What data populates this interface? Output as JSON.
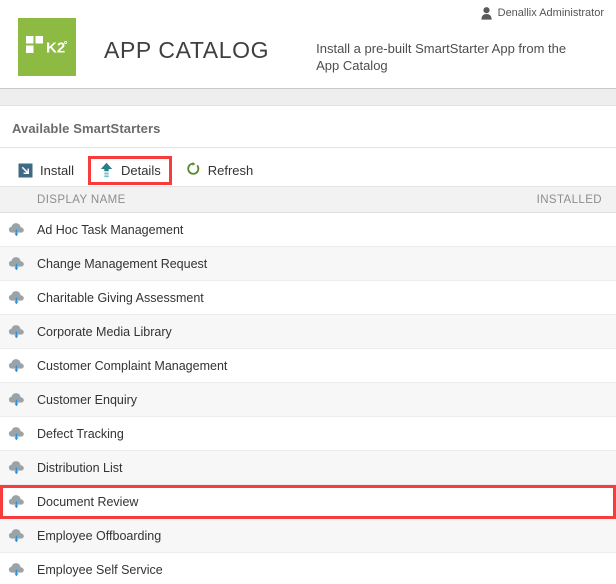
{
  "window": {
    "app_title": "APP CATALOG",
    "description": "Install a pre-built SmartStarter App from the App Catalog"
  },
  "user": {
    "name": "Denallix Administrator",
    "icon": "user-icon"
  },
  "brand": {
    "logo_text": "K2",
    "logo_color": "#8cba42"
  },
  "section": {
    "title": "Available SmartStarters"
  },
  "toolbar": {
    "buttons": [
      {
        "label": "Install",
        "icon": "install-arrow-icon",
        "highlighted": false
      },
      {
        "label": "Details",
        "icon": "details-up-arrow-icon",
        "highlighted": true
      },
      {
        "label": "Refresh",
        "icon": "refresh-circular-arrow-icon",
        "highlighted": false
      }
    ],
    "highlight_color": "#f73c3c"
  },
  "grid": {
    "columns": [
      "DISPLAY NAME",
      "INSTALLED"
    ],
    "rows": [
      {
        "name": "Ad Hoc Task Management",
        "installed": "",
        "highlighted": false
      },
      {
        "name": "Change Management Request",
        "installed": "",
        "highlighted": false
      },
      {
        "name": "Charitable Giving Assessment",
        "installed": "",
        "highlighted": false
      },
      {
        "name": "Corporate Media Library",
        "installed": "",
        "highlighted": false
      },
      {
        "name": "Customer Complaint Management",
        "installed": "",
        "highlighted": false
      },
      {
        "name": "Customer Enquiry",
        "installed": "",
        "highlighted": false
      },
      {
        "name": "Defect Tracking",
        "installed": "",
        "highlighted": false
      },
      {
        "name": "Distribution List",
        "installed": "",
        "highlighted": false
      },
      {
        "name": "Document Review",
        "installed": "",
        "highlighted": true
      },
      {
        "name": "Employee Offboarding",
        "installed": "",
        "highlighted": false
      },
      {
        "name": "Employee Self Service",
        "installed": "",
        "highlighted": false
      }
    ],
    "row_icon": "cloud-download-icon"
  }
}
